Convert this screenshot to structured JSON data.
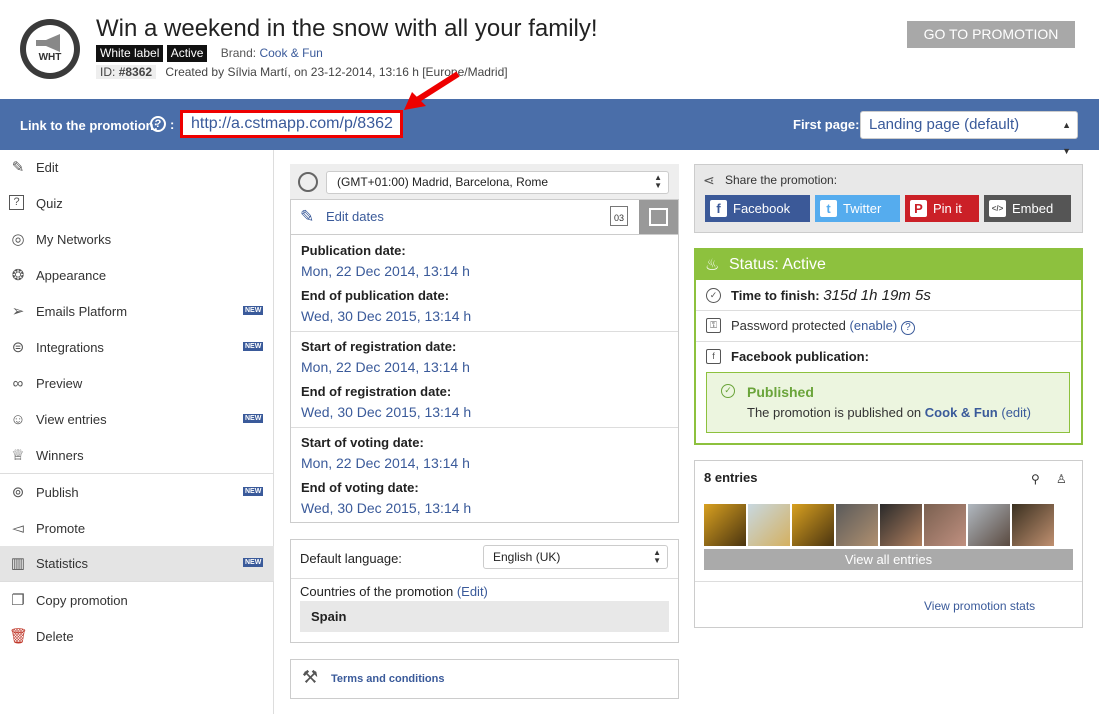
{
  "header": {
    "logo_text": "WHT",
    "title": "Win a weekend in the snow with all your family!",
    "tag_white_label": "White label",
    "tag_active": "Active",
    "brand_label": "Brand:",
    "brand_name": "Cook & Fun",
    "id_label": "ID:",
    "id_value": "#8362",
    "created_text": "Created by Sílvia Martí, on 23-12-2014, 13:16 h [Europe/Madrid]",
    "go_button": "GO TO PROMOTION"
  },
  "linkbar": {
    "label": "Link to the promotion:",
    "help": "?",
    "colon": ":",
    "url": "http://a.cstmapp.com/p/8362",
    "first_page_label": "First page:",
    "first_page_value": "Landing page (default)"
  },
  "sidebar": {
    "items": [
      {
        "label": "Edit",
        "icon": "pencil-icon"
      },
      {
        "label": "Quiz",
        "icon": "quiz-icon"
      },
      {
        "label": "My Networks",
        "icon": "network-icon"
      },
      {
        "label": "Appearance",
        "icon": "palette-icon"
      },
      {
        "label": "Emails Platform",
        "icon": "paper-plane-icon",
        "badge": "NEW"
      },
      {
        "label": "Integrations",
        "icon": "toggle-icon",
        "badge": "NEW"
      },
      {
        "label": "Preview",
        "icon": "glasses-icon"
      },
      {
        "label": "View entries",
        "icon": "user-icon",
        "badge": "NEW"
      },
      {
        "label": "Winners",
        "icon": "trophy-icon"
      },
      {
        "label": "Publish",
        "icon": "broadcast-icon",
        "badge": "NEW"
      },
      {
        "label": "Promote",
        "icon": "megaphone-icon"
      },
      {
        "label": "Statistics",
        "icon": "bar-chart-icon",
        "badge": "NEW"
      },
      {
        "label": "Copy promotion",
        "icon": "copy-icon"
      },
      {
        "label": "Delete",
        "icon": "trash-icon"
      }
    ]
  },
  "dates": {
    "timezone": "(GMT+01:00) Madrid, Barcelona, Rome",
    "edit_dates": "Edit dates",
    "calendar_day": "03",
    "publication_label": "Publication date:",
    "publication_value": "Mon, 22 Dec 2014, 13:14 h",
    "end_publication_label": "End of publication date:",
    "end_publication_value": "Wed, 30 Dec 2015, 13:14 h",
    "start_registration_label": "Start of registration date:",
    "start_registration_value": "Mon, 22 Dec 2014, 13:14 h",
    "end_registration_label": "End of registration date:",
    "end_registration_value": "Wed, 30 Dec 2015, 13:14 h",
    "start_voting_label": "Start of voting date:",
    "start_voting_value": "Mon, 22 Dec 2014, 13:14 h",
    "end_voting_label": "End of voting date:",
    "end_voting_value": "Wed, 30 Dec 2015, 13:14 h"
  },
  "language": {
    "label": "Default language:",
    "value": "English (UK)",
    "countries_label": "Countries of the promotion",
    "countries_edit": "(Edit)",
    "country": "Spain"
  },
  "terms": {
    "label": "Terms and conditions"
  },
  "share": {
    "label": "Share the promotion:",
    "buttons": [
      {
        "label": "Facebook",
        "icon": "f",
        "color": "#3b5998"
      },
      {
        "label": "Twitter",
        "icon": "t",
        "color": "#55acee"
      },
      {
        "label": "Pin it",
        "icon": "P",
        "color": "#cb2027"
      },
      {
        "label": "Embed",
        "icon": "</>",
        "color": "#555555"
      }
    ]
  },
  "status": {
    "title": "Status: Active",
    "time_label": "Time to finish:",
    "time_value": "315d 1h 19m 5s",
    "password_text": "Password protected",
    "password_link": "(enable)",
    "facebook_label": "Facebook publication:",
    "published_title": "Published",
    "published_text": "The promotion is published on",
    "published_page": "Cook & Fun",
    "published_edit": "(edit)",
    "accent_color": "#8dc13e"
  },
  "entries": {
    "count_label": "8 entries",
    "view_all": "View all entries",
    "view_stats": "View promotion stats"
  }
}
